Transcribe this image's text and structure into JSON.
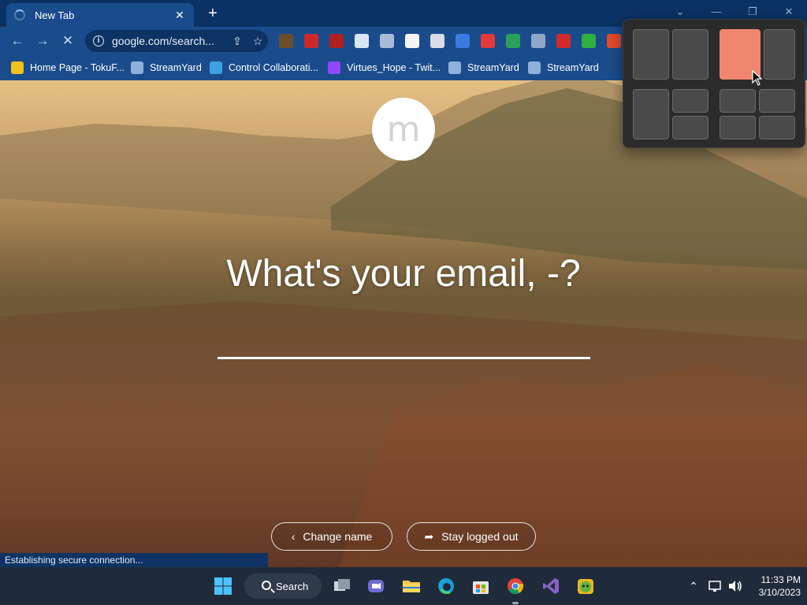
{
  "browser": {
    "tab_title": "New Tab",
    "tab_close": "✕",
    "new_tab": "+",
    "window_controls": [
      "⌄",
      "—",
      "❐",
      "✕"
    ],
    "url": "google.com/search...",
    "nav": {
      "back": "←",
      "forward": "→",
      "stop": "✕"
    },
    "bookmarks": [
      {
        "label": "Home Page - TokuF...",
        "color": "#f2c11a"
      },
      {
        "label": "StreamYard",
        "color": "#8fb0d8"
      },
      {
        "label": "Control Collaborati...",
        "color": "#40a0e0"
      },
      {
        "label": "Virtues_Hope - Twit...",
        "color": "#9146ff"
      },
      {
        "label": "StreamYard",
        "color": "#8fb0d8"
      },
      {
        "label": "StreamYard",
        "color": "#8fb0d8"
      }
    ],
    "extension_colors": [
      "#6b4f2a",
      "#cc2a2a",
      "#b02020",
      "#d8e6f4",
      "#a8bcd8",
      "#f4f4f4",
      "#d8dde6",
      "#3a7be0",
      "#e33a3a",
      "#2aa05a",
      "#8fa8c8",
      "#d12a2a",
      "#30b040",
      "#e04a2a",
      "#d62020"
    ]
  },
  "page": {
    "logo_letter": "m",
    "question": "What's your email, -?",
    "change_name": "Change name",
    "stay_logged_out": "Stay logged out",
    "status": "Establishing secure connection..."
  },
  "taskbar": {
    "search_label": "Search",
    "time": "11:33 PM",
    "date": "3/10/2023"
  },
  "snap_layout": {
    "highlight_color": "#f08570"
  }
}
